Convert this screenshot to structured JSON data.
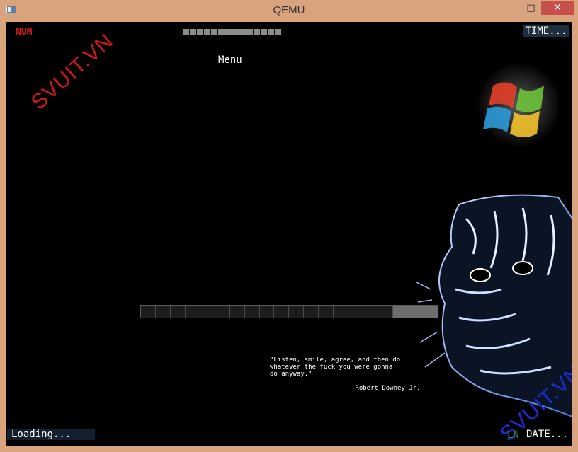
{
  "window": {
    "title": "QEMU",
    "minimize_glyph": "—",
    "maximize_glyph": "□",
    "close_glyph": "✕"
  },
  "screen": {
    "num_indicator": "NUM",
    "time_label": "TIME...",
    "menu_title": "Menu",
    "top_progress_cells": 14,
    "loading_progress": {
      "filled_segments": 17,
      "total_segments": 20,
      "fraction": 0.85
    },
    "quote": {
      "lines": [
        "\"Listen, smile, agree, and then do",
        "whatever the fuck you were gonna",
        "do anyway.\""
      ],
      "author": "-Robert Downey Jr."
    },
    "status": {
      "loading_label": "Loading...",
      "ln_indicator": "LN",
      "date_label": "DATE..."
    },
    "watermark_text": "SVUIT.VN",
    "colors": {
      "num": "#d41a1a",
      "ln": "#1f9a2a",
      "watermark_red": "#d01616",
      "watermark_blue": "#1a2bd8",
      "close_button": "#c7504b",
      "frame": "#d9a37e"
    }
  }
}
